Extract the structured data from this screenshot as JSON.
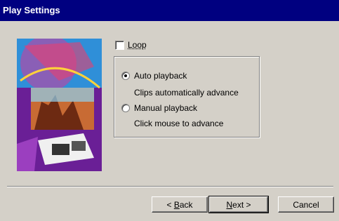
{
  "window": {
    "title": "Play Settings"
  },
  "loop": {
    "label": "Loop",
    "checked": false
  },
  "playback": {
    "auto": {
      "label": "Auto playback",
      "description": "Clips automatically advance",
      "selected": true
    },
    "manual": {
      "label": "Manual playback",
      "description": "Click mouse to advance",
      "selected": false
    }
  },
  "buttons": {
    "back_accel": "B",
    "back_rest": "ack",
    "next_accel": "N",
    "next_rest": "ext >",
    "cancel": "Cancel"
  },
  "colors": {
    "titlebar": "#000080",
    "face": "#d4d0c8"
  },
  "icons": {
    "back_prefix": "<"
  }
}
